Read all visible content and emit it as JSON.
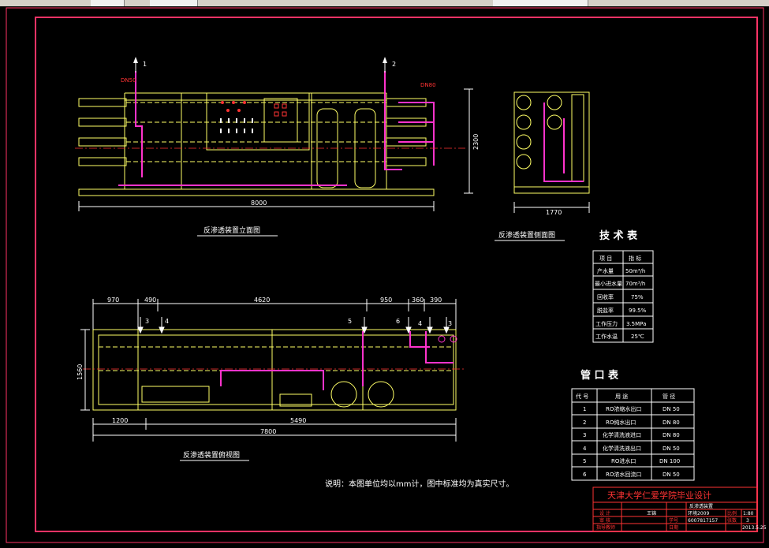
{
  "colors": {
    "background": "#000000",
    "frame": "#ff3366",
    "equipment": "#ffff66",
    "pipe": "#ff33cc",
    "dimension": "#ffffff",
    "center_line": "#ff3333",
    "table_line": "#ffffff",
    "titleblock": "#ff3333",
    "accent_text": "#ff3333"
  },
  "views": {
    "elevation": {
      "title": "反渗透装置立面图",
      "length_dim": "8000",
      "height_dim": "2300",
      "pipe_size_left": "DN50",
      "pipe_size_right": "DN80",
      "nozzle_1": "1",
      "nozzle_2": "2"
    },
    "side": {
      "title": "反渗透装置侧面图",
      "width_dim": "1770"
    },
    "plan": {
      "title": "反渗透装置俯视图",
      "top_dims": [
        "970",
        "490",
        "4620",
        "950",
        "360",
        "390"
      ],
      "bottom_dim_1": "1200",
      "bottom_dim_2": "5490",
      "overall_dim": "7800",
      "side_dim": "1560",
      "nozzles": [
        "3",
        "4",
        "5",
        "6",
        "4",
        "3"
      ]
    }
  },
  "tech_table": {
    "title": "技 术 表",
    "header": [
      "项 目",
      "指 标"
    ],
    "rows": [
      [
        "产水量",
        "50m³/h"
      ],
      [
        "最小进水量",
        "70m³/h"
      ],
      [
        "回收率",
        "75%"
      ],
      [
        "脱盐率",
        "99.5%"
      ],
      [
        "工作压力",
        "3.5MPa"
      ],
      [
        "工作水温",
        "25℃"
      ]
    ]
  },
  "nozzle_table": {
    "title": "管 口 表",
    "header": [
      "代 号",
      "用 途",
      "管 径"
    ],
    "rows": [
      [
        "1",
        "RO浓缩水出口",
        "DN 50"
      ],
      [
        "2",
        "RO纯水出口",
        "DN 80"
      ],
      [
        "3",
        "化学清洗液进口",
        "DN 80"
      ],
      [
        "4",
        "化学清洗液出口",
        "DN 50"
      ],
      [
        "5",
        "RO进水口",
        "DN 100"
      ],
      [
        "6",
        "RO浓水回流口",
        "DN 50"
      ]
    ]
  },
  "note": "说明：本图单位均以mm计，图中标准均为真实尺寸。",
  "title_block": {
    "school": "天津大学仁爱学院毕业设计",
    "drawing_name": "反渗透装置",
    "row2": [
      "设 计",
      "",
      "图号",
      ""
    ],
    "row2_vals": [
      "王锦",
      "环境2009",
      "比例",
      "1:80"
    ],
    "row3": [
      "审 核",
      "",
      "学号",
      "6007817157",
      "张数",
      "3"
    ],
    "row4": [
      "指导教师",
      "",
      "日期",
      "2013.5.25"
    ]
  }
}
